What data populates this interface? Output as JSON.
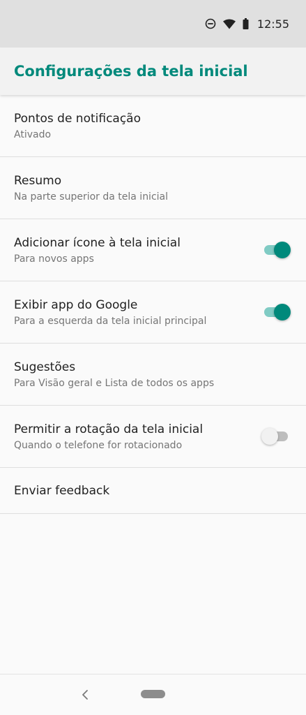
{
  "status_bar": {
    "time": "12:55",
    "icons": [
      "dnd-icon",
      "wifi-icon",
      "battery-icon"
    ]
  },
  "app_bar": {
    "title": "Configurações da tela inicial"
  },
  "settings": [
    {
      "title": "Pontos de notificação",
      "summary": "Ativado"
    },
    {
      "title": "Resumo",
      "summary": "Na parte superior da tela inicial"
    },
    {
      "title": "Adicionar ícone à tela inicial",
      "summary": "Para novos apps",
      "toggle": true
    },
    {
      "title": "Exibir app do Google",
      "summary": "Para a esquerda da tela inicial principal",
      "toggle": true
    },
    {
      "title": "Sugestões",
      "summary": "Para Visão geral e Lista de todos os apps"
    },
    {
      "title": "Permitir a rotação da tela inicial",
      "summary": "Quando o telefone for rotacionado",
      "toggle": false
    },
    {
      "title": "Enviar feedback"
    }
  ],
  "colors": {
    "accent": "#00897b",
    "accent_light": "#80cbc4"
  },
  "nav_bar": {
    "icons": [
      "back-icon",
      "home-pill-icon"
    ]
  }
}
